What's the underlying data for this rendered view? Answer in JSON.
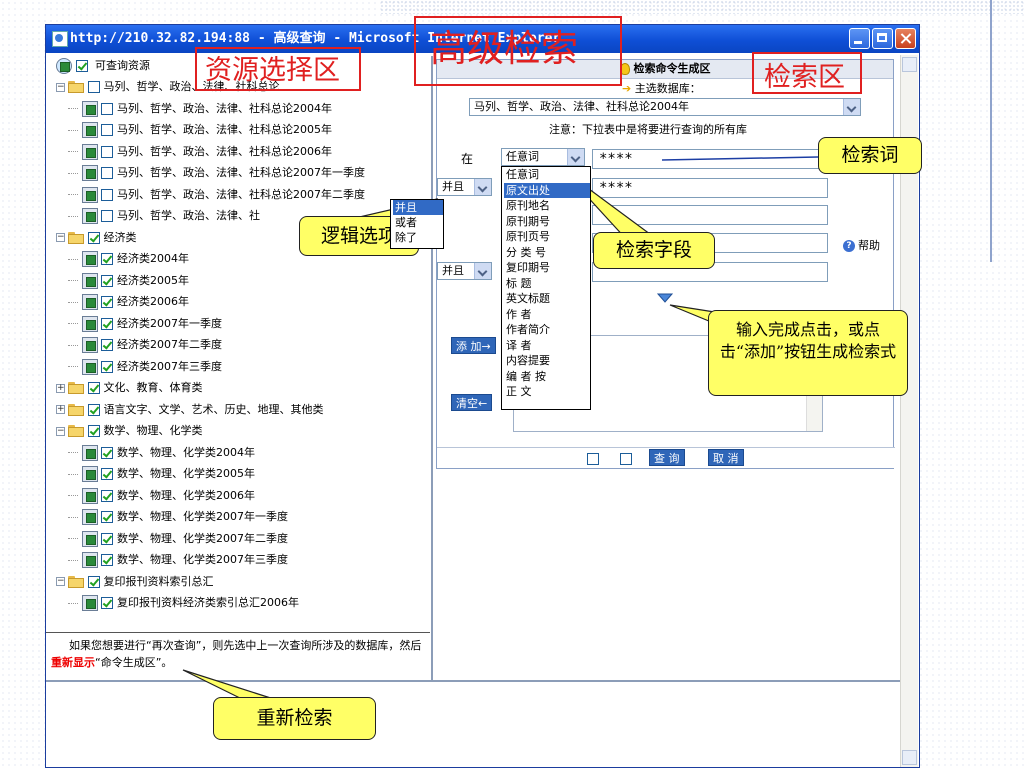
{
  "window": {
    "title": "http://210.32.82.194:88 - 高级查询 - Microsoft Internet Explorer"
  },
  "tree": {
    "root_label": "可查询资源",
    "groups": [
      {
        "label": "马列、哲学、政治、法律、社科总论",
        "checked": false,
        "expanded": true,
        "items": [
          {
            "label": "马列、哲学、政治、法律、社科总论2004年",
            "checked": false
          },
          {
            "label": "马列、哲学、政治、法律、社科总论2005年",
            "checked": false
          },
          {
            "label": "马列、哲学、政治、法律、社科总论2006年",
            "checked": false
          },
          {
            "label": "马列、哲学、政治、法律、社科总论2007年一季度",
            "checked": false
          },
          {
            "label": "马列、哲学、政治、法律、社科总论2007年二季度",
            "checked": false
          },
          {
            "label": "马列、哲学、政治、法律、社",
            "checked": false
          }
        ]
      },
      {
        "label": "经济类",
        "checked": true,
        "expanded": true,
        "items": [
          {
            "label": "经济类2004年",
            "checked": true
          },
          {
            "label": "经济类2005年",
            "checked": true
          },
          {
            "label": "经济类2006年",
            "checked": true
          },
          {
            "label": "经济类2007年一季度",
            "checked": true
          },
          {
            "label": "经济类2007年二季度",
            "checked": true
          },
          {
            "label": "经济类2007年三季度",
            "checked": true
          }
        ]
      },
      {
        "label": "文化、教育、体育类",
        "checked": true,
        "expanded": false,
        "items": []
      },
      {
        "label": "语言文字、文学、艺术、历史、地理、其他类",
        "checked": true,
        "expanded": false,
        "items": []
      },
      {
        "label": "数学、物理、化学类",
        "checked": true,
        "expanded": true,
        "items": [
          {
            "label": "数学、物理、化学类2004年",
            "checked": true
          },
          {
            "label": "数学、物理、化学类2005年",
            "checked": true
          },
          {
            "label": "数学、物理、化学类2006年",
            "checked": true
          },
          {
            "label": "数学、物理、化学类2007年一季度",
            "checked": true
          },
          {
            "label": "数学、物理、化学类2007年二季度",
            "checked": true
          },
          {
            "label": "数学、物理、化学类2007年三季度",
            "checked": true
          }
        ]
      },
      {
        "label": "复印报刊资料索引总汇",
        "checked": true,
        "expanded": true,
        "items": [
          {
            "label": "复印报刊资料经济类索引总汇2006年",
            "checked": true
          }
        ]
      }
    ]
  },
  "bottom_note": {
    "text1": "如果您想要进行“再次查询”，则先选中上一次查询所涉及的数据库，然后",
    "highlight": "重新显示",
    "text2": "“命令生成区”。"
  },
  "command_panel": {
    "header": "检索命令生成区",
    "db_label": "主选数据库：",
    "db_value": "马列、哲学、政治、法律、社科总论2004年",
    "note": "注意：下拉表中是将要进行查询的所有库",
    "in_label": "在",
    "field_value": "任意词",
    "term1": "****",
    "term2": "****",
    "logic_value": "并且",
    "logic_value_last": "并且",
    "help_label": "帮助",
    "add_button": "添 加→",
    "clear_button": "清空←",
    "query_button": "查 询",
    "cancel_button": "取 消"
  },
  "field_dropdown": {
    "options": [
      "任意词",
      "原文出处",
      "原刊地名",
      "原刊期号",
      "原刊页号",
      "分 类 号",
      "复印期号",
      "标 题",
      "英文标题",
      "作 者",
      "作者简介",
      "译 者",
      "内容提要",
      "编 者 按",
      "正 文"
    ],
    "selected": "原文出处"
  },
  "logic_dropdown": {
    "options": [
      "并且",
      "或者",
      "除了"
    ],
    "selected": "并且"
  },
  "annotations": {
    "resource_area": "资源选择区",
    "advanced_search": "高级检索",
    "search_area": "检索区",
    "search_term": "检索词",
    "logic_option": "逻辑选项",
    "search_field": "检索字段",
    "generate_hint": "输入完成点击，或点击“添加”按钮生成检索式",
    "re_search": "重新检索"
  },
  "colors": {
    "titlebar": "#0f4fd6",
    "annotation_red": "#e02020",
    "callout_yellow": "#ffff66",
    "selection_blue": "#316ac5"
  }
}
